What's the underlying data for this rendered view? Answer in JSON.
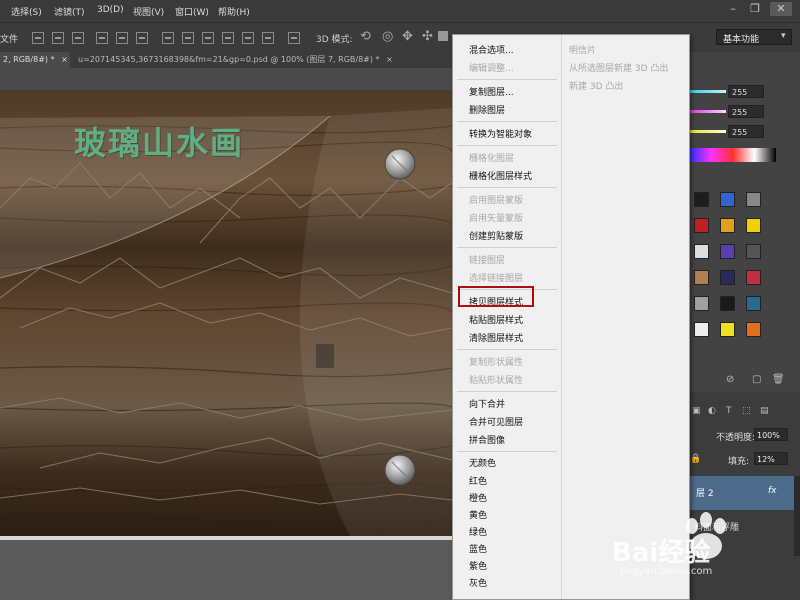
{
  "menubar": {
    "items": [
      {
        "label": "选择(S)"
      },
      {
        "label": "滤镜(T)"
      },
      {
        "label": "3D(D)"
      },
      {
        "label": "视图(V)"
      },
      {
        "label": "窗口(W)"
      },
      {
        "label": "帮助(H)"
      }
    ],
    "window_controls": {
      "minimize": "–",
      "restore": "❐",
      "close": "✕"
    }
  },
  "optionsbar": {
    "left_label": "文件",
    "mode_label": "3D 模式:",
    "workspace": "基本功能"
  },
  "tabs": [
    {
      "label": "2, RGB/8#) *",
      "close": "×"
    },
    {
      "label": "u=207145345,3673168398&fm=21&gp=0.psd @ 100% (图层 7, RGB/8#) *",
      "close": "×"
    }
  ],
  "canvas": {
    "title": "玻璃山水画"
  },
  "color_panel": {
    "values": [
      "255",
      "255",
      "255"
    ]
  },
  "layers_panel": {
    "opacity_label": "不透明度:",
    "opacity_value": "100%",
    "fill_label": "填充:",
    "fill_value": "12%",
    "layer_name": "层 2",
    "fx": "fx",
    "effect_label": "斜面和浮雕"
  },
  "context_menu": {
    "items": [
      {
        "label": "混合选项...",
        "enabled": true
      },
      {
        "label": "编辑调整...",
        "enabled": false
      },
      {
        "label": "复制图层...",
        "enabled": true
      },
      {
        "label": "删除图层",
        "enabled": true
      },
      {
        "label": "转换为智能对象",
        "enabled": true
      },
      {
        "label": "栅格化图层",
        "enabled": false
      },
      {
        "label": "栅格化图层样式",
        "enabled": true
      },
      {
        "label": "启用图层蒙版",
        "enabled": false
      },
      {
        "label": "启用矢量蒙版",
        "enabled": false
      },
      {
        "label": "创建剪贴蒙版",
        "enabled": true
      },
      {
        "label": "链接图层",
        "enabled": false
      },
      {
        "label": "选择链接图层",
        "enabled": false
      },
      {
        "label": "拷贝图层样式",
        "enabled": true,
        "highlighted": true
      },
      {
        "label": "粘贴图层样式",
        "enabled": true
      },
      {
        "label": "清除图层样式",
        "enabled": true
      },
      {
        "label": "复制形状属性",
        "enabled": false
      },
      {
        "label": "粘贴形状属性",
        "enabled": false
      },
      {
        "label": "向下合并",
        "enabled": true
      },
      {
        "label": "合并可见图层",
        "enabled": true
      },
      {
        "label": "拼合图像",
        "enabled": true
      },
      {
        "label": "无颜色",
        "enabled": true
      },
      {
        "label": "红色",
        "enabled": true
      },
      {
        "label": "橙色",
        "enabled": true
      },
      {
        "label": "黄色",
        "enabled": true
      },
      {
        "label": "绿色",
        "enabled": true
      },
      {
        "label": "蓝色",
        "enabled": true
      },
      {
        "label": "紫色",
        "enabled": true
      },
      {
        "label": "灰色",
        "enabled": true
      }
    ],
    "right_items": [
      {
        "label": "明信片",
        "enabled": false
      },
      {
        "label": "从所选图层新建 3D 凸出",
        "enabled": false
      },
      {
        "label": "新建 3D 凸出",
        "enabled": false
      }
    ]
  },
  "watermark": {
    "brand": "Bai经验",
    "url": "jingyan.baidu.com"
  },
  "colors": {
    "title_green": "#5fae84",
    "highlight_border": "#b00e0e",
    "menu_bg": "#f0f0f0"
  }
}
